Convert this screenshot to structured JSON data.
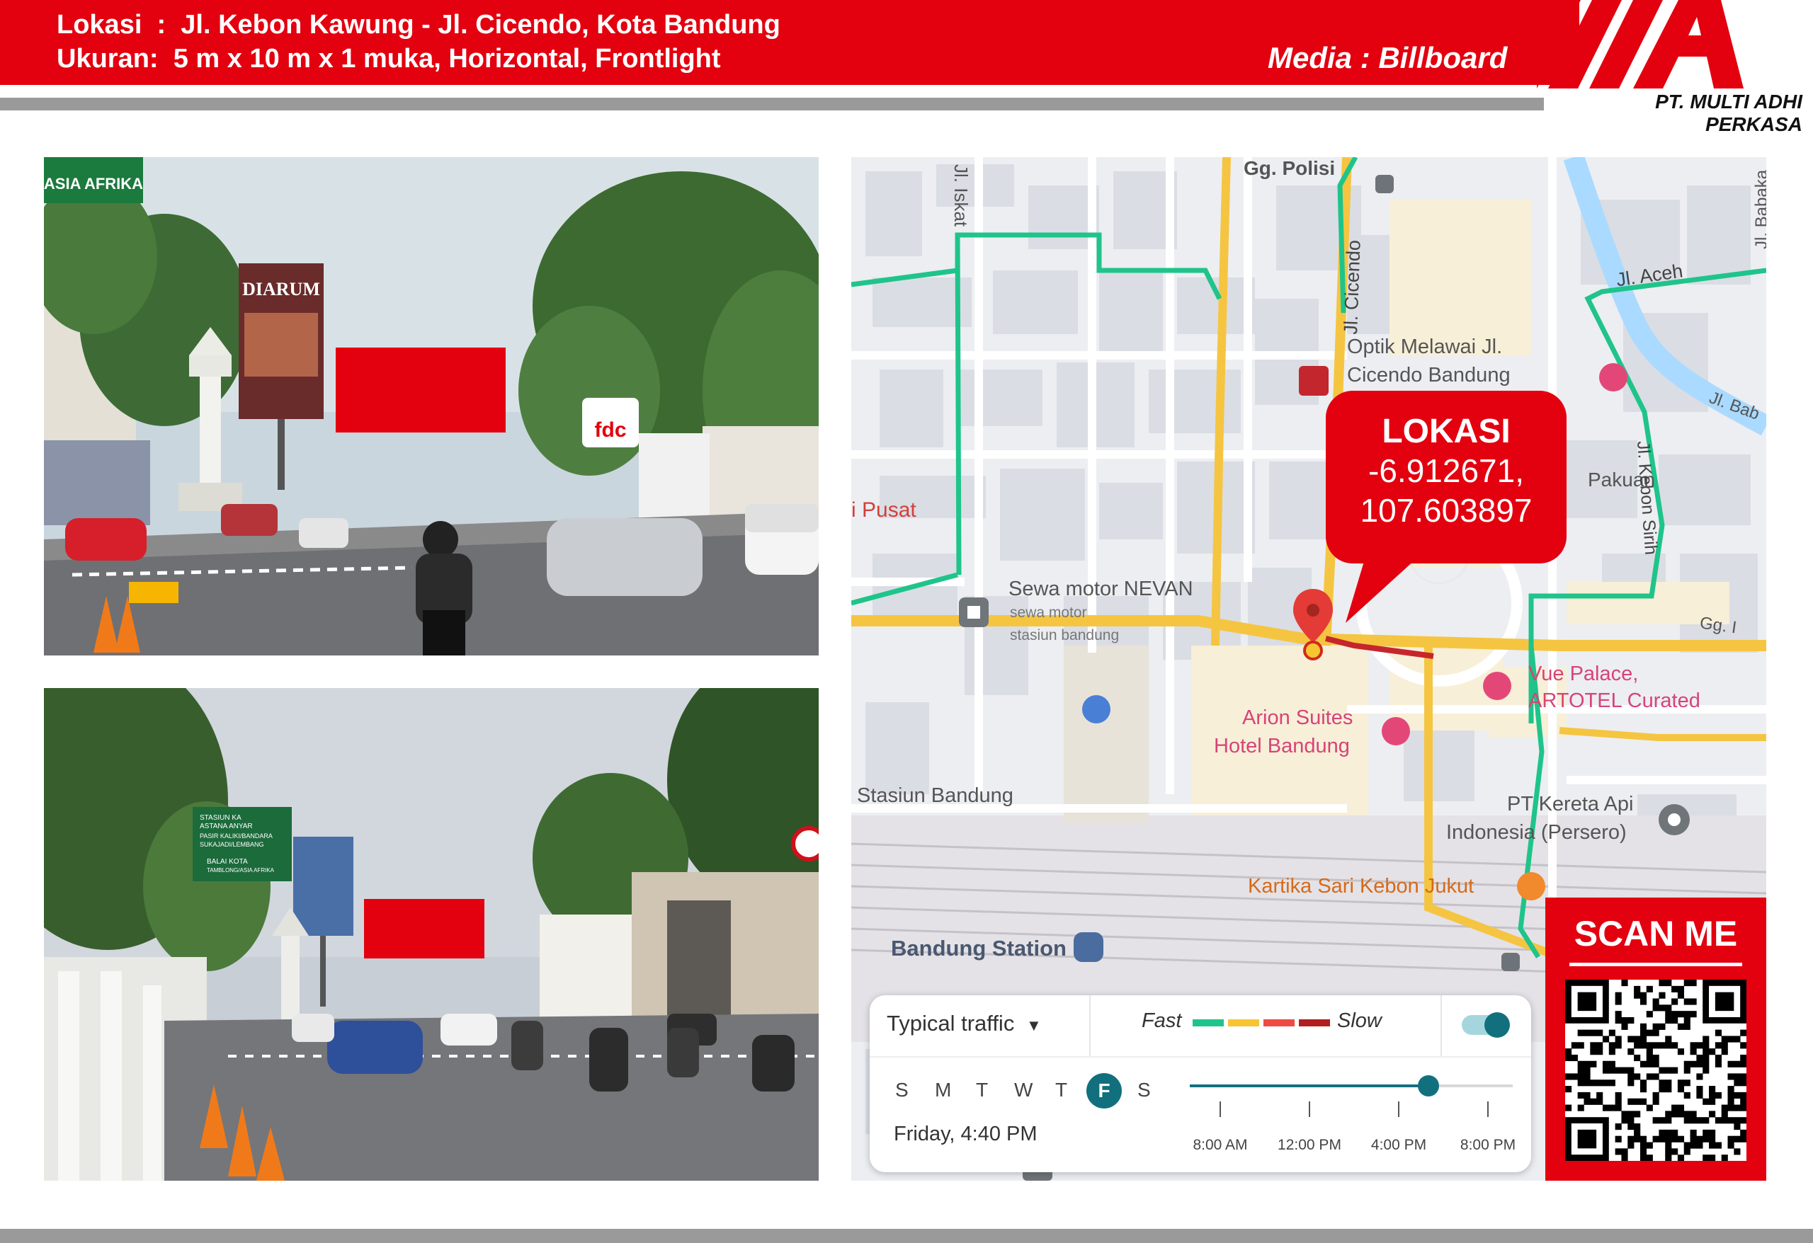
{
  "header": {
    "location_label": "Lokasi  :",
    "location_value": "Jl. Kebon Kawung - Jl. Cicendo, Kota Bandung",
    "size_label": "Ukuran:",
    "size_value": "5 m x 10 m x 1 muka, Horizontal, Frontlight",
    "media": "Media : Billboard"
  },
  "brand": {
    "company": "PT. MULTI ADHI PERKASA",
    "accent_color": "#e3000f"
  },
  "photo_top": {
    "sign_asia": "ASIA AFRIKA",
    "sign_diarum": "DIARUM",
    "sign_fdc": "fdc"
  },
  "photo_bottom": {
    "sign_line1": "STASIUN KA",
    "sign_line2": "ASTANA ANYAR",
    "sign_line3": "PASIR KALIKI/BANDARA",
    "sign_line4": "SUKAJADI/LEMBANG",
    "sign_line5": "BALAI KOTA",
    "sign_line6": "TAMBLONG/ASIA AFRIKA"
  },
  "map": {
    "labels": {
      "gg_polisi": "Gg. Polisi",
      "jl_iskat": "Jl. Iskat",
      "jl_cicendo": "Jl. Cicendo",
      "jl_babakan": "Jl. Babaka",
      "jl_aceh": "Jl. Aceh",
      "jl_bab": "Jl. Bab",
      "optik1": "Optik Melawai Jl.",
      "optik2": "Cicendo Bandung",
      "pusat": "i Pusat",
      "pakuan": "Pakuan",
      "kebon_sirih": "Jl. Kebon Sirih",
      "sewa1": "Sewa motor NEVAN",
      "sewa2": "sewa motor",
      "sewa3": "stasiun bandung",
      "gg_i": "Gg. I",
      "vue1": "Vue Palace,",
      "vue2": "ARTOTEL Curated",
      "arion1": "Arion Suites",
      "arion2": "Hotel Bandung",
      "stasiun": "Stasiun Bandung",
      "kai1": "PT Kereta Api",
      "kai2": "Indonesia (Persero)",
      "kartika": "Kartika Sari Kebon Jukut",
      "bandung_station": "Bandung Station"
    },
    "callout_title": "LOKASI",
    "callout_lat": "-6.912671,",
    "callout_lng": "107.603897"
  },
  "traffic": {
    "mode": "Typical traffic",
    "fast": "Fast",
    "slow": "Slow",
    "days": [
      "S",
      "M",
      "T",
      "W",
      "T",
      "F",
      "S"
    ],
    "selected_day": "Friday, 4:40 PM",
    "times": [
      "8:00 AM",
      "12:00 PM",
      "4:00 PM",
      "8:00 PM"
    ],
    "slider_fraction": 0.74,
    "colors": [
      "#1fc48a",
      "#f7c531",
      "#ee4b42",
      "#b21d1d"
    ]
  },
  "scan": {
    "title": "SCAN ME"
  }
}
